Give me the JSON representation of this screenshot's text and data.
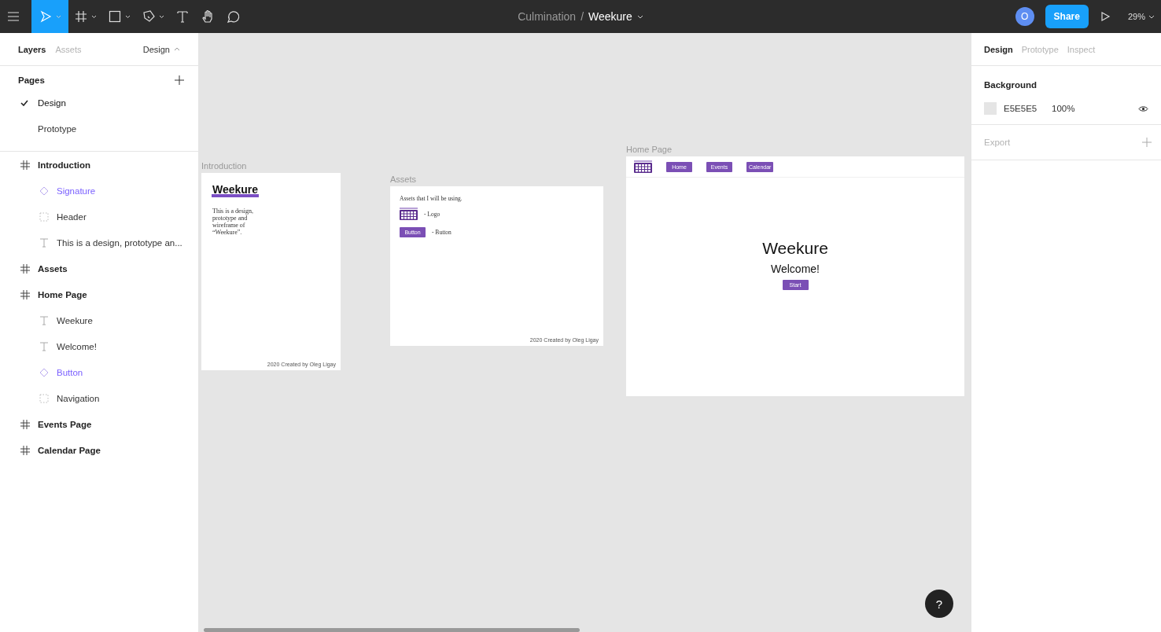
{
  "toolbar": {
    "tools": [
      {
        "kind": "menu",
        "selected": false,
        "dropdown": false
      },
      {
        "kind": "move",
        "selected": true,
        "dropdown": true
      },
      {
        "kind": "frame",
        "selected": false,
        "dropdown": true
      },
      {
        "kind": "rect",
        "selected": false,
        "dropdown": true
      },
      {
        "kind": "pen",
        "selected": false,
        "dropdown": true
      },
      {
        "kind": "text",
        "selected": false,
        "dropdown": false
      },
      {
        "kind": "hand",
        "selected": false,
        "dropdown": false
      },
      {
        "kind": "comment",
        "selected": false,
        "dropdown": false
      }
    ],
    "project": "Culmination",
    "separator": "/",
    "file": "Weekure",
    "avatar": "O",
    "share": "Share",
    "zoom": "29%"
  },
  "left_panel": {
    "tabs": [
      {
        "label": "Layers",
        "selected": true
      },
      {
        "label": "Assets",
        "selected": false
      }
    ],
    "page_menu": "Design",
    "pages_title": "Pages",
    "pages": [
      {
        "label": "Design",
        "selected": true
      },
      {
        "label": "Prototype",
        "selected": false
      }
    ],
    "layers": [
      {
        "name": "Introduction",
        "kind": "frame",
        "children": [
          {
            "name": "Signature",
            "kind": "component"
          },
          {
            "name": "Header",
            "kind": "group"
          },
          {
            "name": "This is a design, prototype an...",
            "kind": "text"
          }
        ]
      },
      {
        "name": "Assets",
        "kind": "frame"
      },
      {
        "name": "Home Page",
        "kind": "frame",
        "children": [
          {
            "name": "Weekure",
            "kind": "text"
          },
          {
            "name": "Welcome!",
            "kind": "text"
          },
          {
            "name": "Button",
            "kind": "component"
          },
          {
            "name": "Navigation",
            "kind": "group"
          }
        ]
      },
      {
        "name": "Events Page",
        "kind": "frame"
      },
      {
        "name": "Calendar Page",
        "kind": "frame"
      }
    ]
  },
  "canvas": {
    "frames": [
      {
        "label": "Introduction",
        "kind": "intro",
        "heading": "Weekure",
        "body": "This is a design, prototype and wireframe of “Weekure”.",
        "footer": "2020 Created by Oleg Ligay"
      },
      {
        "label": "Assets",
        "kind": "assets",
        "intro": "Assets that I will be using.",
        "items": [
          {
            "kind": "logo",
            "caption": "- Logo"
          },
          {
            "kind": "button",
            "button": "Button",
            "caption": "- Button"
          }
        ],
        "footer": "2020 Created by Oleg Ligay"
      },
      {
        "label": "Home Page",
        "kind": "home",
        "nav": [
          "Home",
          "Events",
          "Calendar"
        ],
        "title": "Weekure",
        "subtitle": "Welcome!",
        "button": "Start"
      }
    ]
  },
  "right_panel": {
    "tabs": [
      {
        "label": "Design",
        "selected": true
      },
      {
        "label": "Prototype",
        "selected": false
      },
      {
        "label": "Inspect",
        "selected": false
      }
    ],
    "background": {
      "title": "Background",
      "color": "#e5e5e5",
      "hex": "E5E5E5",
      "opacity": "100%"
    },
    "export": {
      "title": "Export"
    }
  },
  "help": "?"
}
